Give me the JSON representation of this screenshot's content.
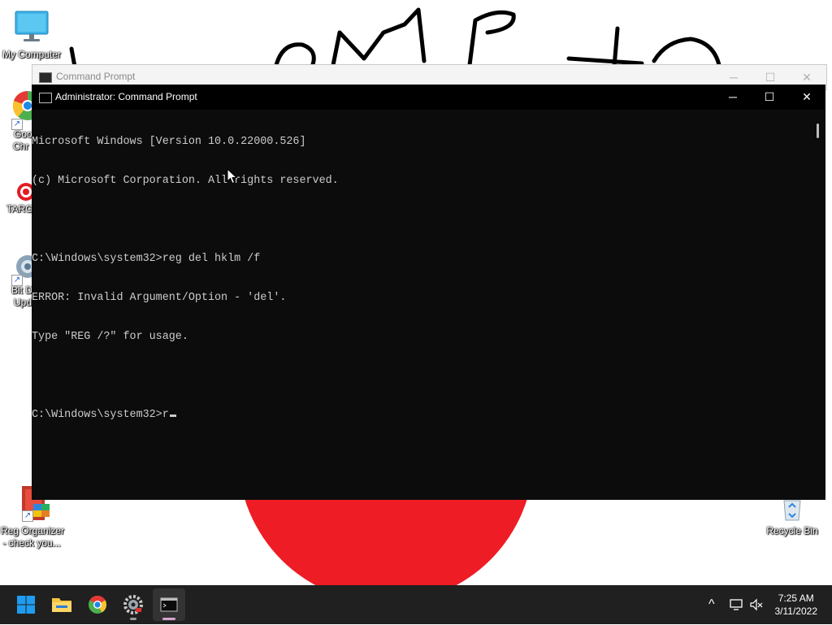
{
  "desktop": {
    "icons": {
      "my_computer": "My Computer",
      "chrome_partial_1": "Goo",
      "chrome_partial_2": "Chr",
      "target_partial": "TARG",
      "bit_partial_1": "Bit D",
      "bit_partial_2": "Upd",
      "reg_organizer_1": "Reg Organizer",
      "reg_organizer_2": "- check you...",
      "recycle_bin": "Recycle Bin"
    }
  },
  "back_window": {
    "title": "Command Prompt"
  },
  "cmd_window": {
    "title": "Administrator: Command Prompt",
    "lines": [
      "Microsoft Windows [Version 10.0.22000.526]",
      "(c) Microsoft Corporation. All rights reserved.",
      "",
      "C:\\Windows\\system32>reg del hklm /f",
      "ERROR: Invalid Argument/Option - 'del'.",
      "Type \"REG /?\" for usage.",
      "",
      "C:\\Windows\\system32>r"
    ]
  },
  "window_controls": {
    "minimize": "─",
    "maximize": "☐",
    "close": "✕"
  },
  "taskbar": {
    "time": "7:25 AM",
    "date": "3/11/2022",
    "tray_chevron": "^"
  },
  "colors": {
    "console_bg": "#0c0c0c",
    "console_text": "#cccccc",
    "taskbar_bg": "#202020",
    "accent_blue": "#1e90ff"
  }
}
